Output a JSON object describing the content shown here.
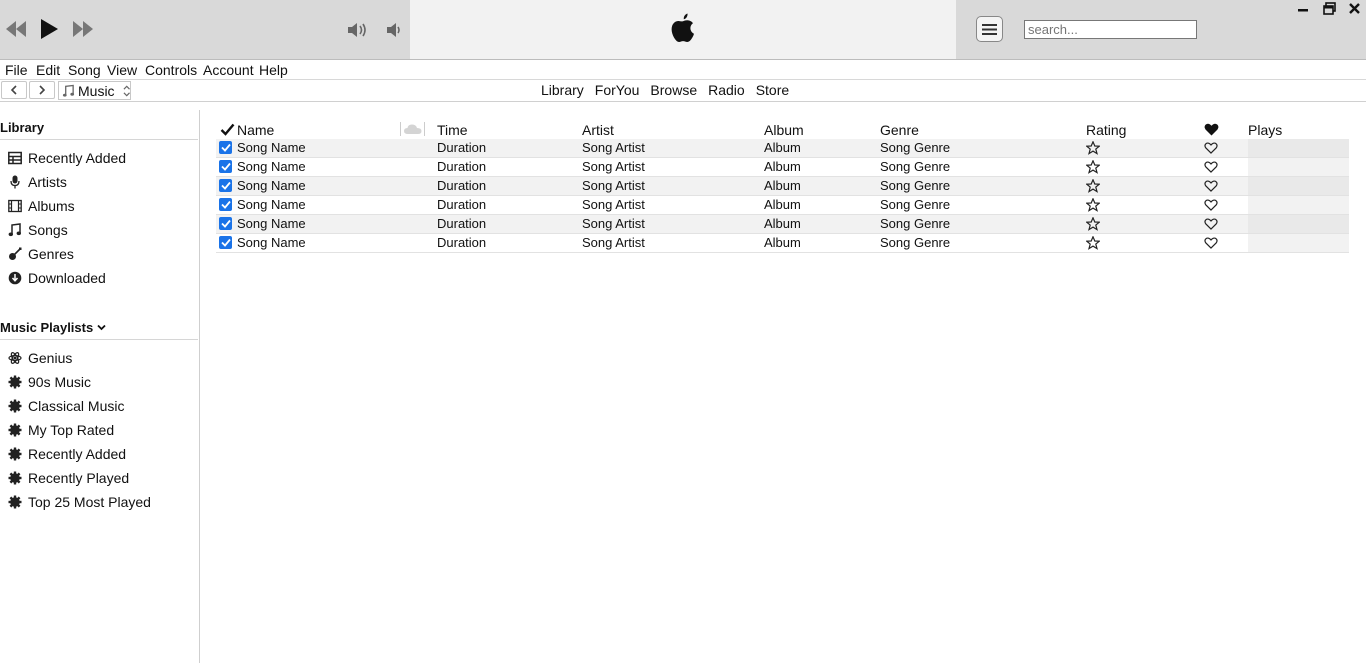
{
  "search": {
    "placeholder": "search..."
  },
  "menu": [
    "File",
    "Edit",
    "Song",
    "View",
    "Controls",
    "Account",
    "Help"
  ],
  "media_selector": "Music",
  "nav_links": [
    "Library",
    "ForYou",
    "Browse",
    "Radio",
    "Store"
  ],
  "sidebar": {
    "library_title": "Library",
    "library_items": [
      {
        "label": "Recently Added",
        "icon": "grid-icon"
      },
      {
        "label": "Artists",
        "icon": "microphone-icon"
      },
      {
        "label": "Albums",
        "icon": "film-icon"
      },
      {
        "label": "Songs",
        "icon": "music-note-icon"
      },
      {
        "label": "Genres",
        "icon": "guitar-icon"
      },
      {
        "label": "Downloaded",
        "icon": "download-icon"
      }
    ],
    "playlists_title": "Music Playlists",
    "playlist_items": [
      {
        "label": "Genius",
        "icon": "atom-icon"
      },
      {
        "label": "90s Music",
        "icon": "gear-icon"
      },
      {
        "label": "Classical Music",
        "icon": "gear-icon"
      },
      {
        "label": "My Top Rated",
        "icon": "gear-icon"
      },
      {
        "label": "Recently Added",
        "icon": "gear-icon"
      },
      {
        "label": "Recently Played",
        "icon": "gear-icon"
      },
      {
        "label": "Top 25 Most Played",
        "icon": "gear-icon"
      }
    ]
  },
  "table": {
    "columns": {
      "name": "Name",
      "time": "Time",
      "artist": "Artist",
      "album": "Album",
      "genre": "Genre",
      "rating": "Rating",
      "plays": "Plays"
    },
    "rows": [
      {
        "name": "Song Name",
        "time": "Duration",
        "artist": "Song Artist",
        "album": "Album",
        "genre": "Song Genre"
      },
      {
        "name": "Song Name",
        "time": "Duration",
        "artist": "Song Artist",
        "album": "Album",
        "genre": "Song Genre"
      },
      {
        "name": "Song Name",
        "time": "Duration",
        "artist": "Song Artist",
        "album": "Album",
        "genre": "Song Genre"
      },
      {
        "name": "Song Name",
        "time": "Duration",
        "artist": "Song Artist",
        "album": "Album",
        "genre": "Song Genre"
      },
      {
        "name": "Song Name",
        "time": "Duration",
        "artist": "Song Artist",
        "album": "Album",
        "genre": "Song Genre"
      },
      {
        "name": "Song Name",
        "time": "Duration",
        "artist": "Song Artist",
        "album": "Album",
        "genre": "Song Genre"
      }
    ]
  },
  "colors": {
    "checkbox": "#1a73e8",
    "topbar": "#d9d9d9",
    "topbar_center": "#f2f2f2"
  }
}
